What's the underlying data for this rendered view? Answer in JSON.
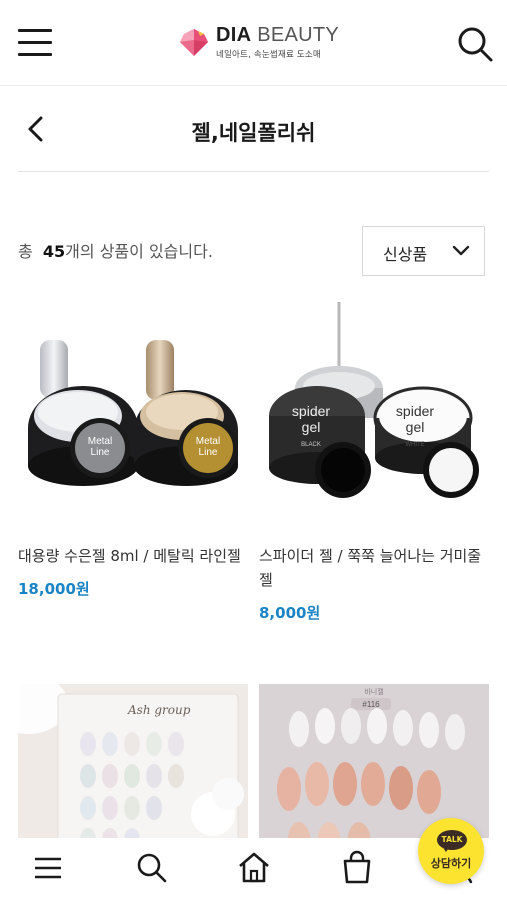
{
  "header": {
    "logo_name_bold": "DIA",
    "logo_name_thin": "BEAUTY",
    "logo_tagline": "네일아트, 속눈썹재료 도소매"
  },
  "page": {
    "title": "젤,네일폴리쉬",
    "count_prefix": "총",
    "count_value": "45",
    "count_suffix": "개의 상품이 있습니다.",
    "sort_selected": "신상품"
  },
  "products": [
    {
      "name": "대용량 수은젤 8ml / 메탈릭 라인젤",
      "price": "18,000원",
      "jar_labels": [
        "Metal",
        "Line"
      ]
    },
    {
      "name": "스파이더 젤 / 쭉쭉 늘어나는 거미줄젤",
      "price": "8,000원",
      "jar_labels": [
        "spider",
        "gel",
        "BLACK",
        "WHITE"
      ]
    },
    {
      "name": "",
      "price": "",
      "card_text": "Ash group"
    },
    {
      "name": "",
      "price": "",
      "card_text": "#116"
    }
  ],
  "chat": {
    "label": "상담하기",
    "bubble": "TALK"
  },
  "icons": [
    "menu-icon",
    "search-icon",
    "back-arrow-icon",
    "chevron-down-icon",
    "home-icon",
    "shopping-bag-icon",
    "kakao-talk-icon"
  ],
  "colors": {
    "price": "#1b84c6",
    "kakao": "#fce330",
    "logo_pink": "#e8507a"
  }
}
